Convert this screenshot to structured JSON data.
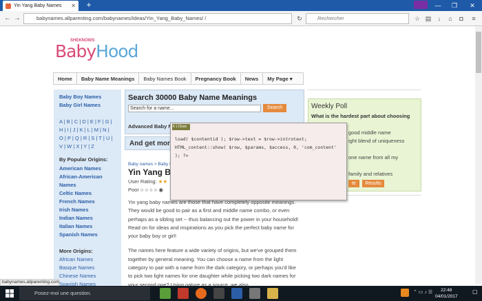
{
  "browser": {
    "tab_title": "Yin Yang Baby Names",
    "url": "babynames.allparenting.com/babynames/Ideas/Yin_Yang_Baby_Names/ /",
    "search_placeholder": "Rechercher",
    "status_url": "babynames.allparenting.com"
  },
  "logo": {
    "brand": "SHEKNOWS",
    "part1": "Baby",
    "part2": "Hood"
  },
  "menu": [
    {
      "label": "Home",
      "style": "bold"
    },
    {
      "label": "Baby Name Meanings",
      "style": "bold"
    },
    {
      "label": "Baby Names Book",
      "style": "light"
    },
    {
      "label": "Pregnancy Book",
      "style": "bold"
    },
    {
      "label": "News",
      "style": "bold"
    },
    {
      "label": "My Page",
      "style": "bold"
    }
  ],
  "sidebar": {
    "top_links": [
      "Baby Boy Names",
      "Baby Girl Names"
    ],
    "alpha": [
      "A | B | C | D | E | F | G |",
      "H | I | J | K | L | M | N |",
      "O | P | Q | R | S | T | U |",
      "V | W | X | Y | Z"
    ],
    "popular_heading": "By Popular Origins:",
    "popular": [
      "American Names",
      "African-American",
      "Names",
      "Celtic Names",
      "French Names",
      "Irish Names",
      "Indian Names",
      "Italian Names",
      "Spanish Names"
    ],
    "more_heading": "More Origins:",
    "more": [
      "African Names",
      "Basque Names",
      "Chinese Names",
      "Spanish Names"
    ]
  },
  "search": {
    "title": "Search 30000 Baby Name Meanings",
    "input_value": "Search for a name...",
    "button": "Search",
    "advanced": "Advanced Baby N"
  },
  "getmore": "And get more",
  "article": {
    "crumb": "Baby names > Baby N",
    "title": "Yin Yang Ba",
    "rating_label": "User Rating:",
    "poor": "Poor",
    "p1": "Yin yang baby names are those that have completely opposite meanings. They would be good to pair as a first and middle name combo, or even perhaps as a sibling set -- thus balancing out the power in your household! Read on for ideas and inspirations as you pick the perfect baby name for your baby boy or girl!",
    "p2": "The names here feature a wide variety of origins, but we've grouped them together by general meaning. You can choose a name from the light category to pair with a name from the dark category, or perhaps you'd like to pick two light names for one daughter while picking two dark names for your second one? Using nature as a source, we also"
  },
  "poll": {
    "title": "Weekly Poll",
    "question": "What is the hardest part about choosing",
    "opt1": "good middle name",
    "opt2": "ight blend of uniqueness",
    "opt3": "",
    "opt4": "one name from all my",
    "opt5": "family and relatives",
    "vote": "te",
    "results": "Results"
  },
  "popup": {
    "badge": "K | Close",
    "line1": "load( $contentid ); $row->text = $row->introtext;",
    "line2": "HTML_content::show( $row, $params, $access, 0, 'com_content' ); ?>"
  },
  "taskbar": {
    "search_placeholder": "Posez-moi une question.",
    "time": "22:48",
    "date": "04/01/2017"
  }
}
